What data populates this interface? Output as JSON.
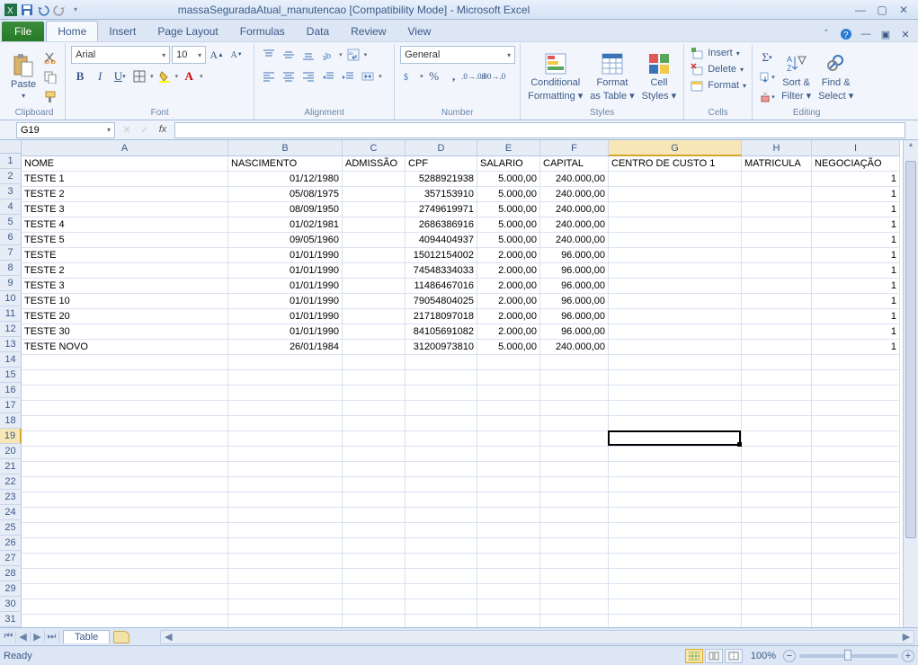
{
  "title": "massaSeguradaAtual_manutencao  [Compatibility Mode] - Microsoft Excel",
  "tabs": {
    "file": "File",
    "home": "Home",
    "insert": "Insert",
    "pagelayout": "Page Layout",
    "formulas": "Formulas",
    "data": "Data",
    "review": "Review",
    "view": "View"
  },
  "ribbon": {
    "clipboard": {
      "paste": "Paste",
      "label": "Clipboard"
    },
    "font": {
      "name": "Arial",
      "size": "10",
      "label": "Font"
    },
    "alignment": {
      "label": "Alignment"
    },
    "number": {
      "format": "General",
      "label": "Number"
    },
    "styles": {
      "cond": "Conditional",
      "cond2": "Formatting",
      "table": "Format",
      "table2": "as Table",
      "cell": "Cell",
      "cell2": "Styles",
      "label": "Styles"
    },
    "cells": {
      "insert": "Insert",
      "delete": "Delete",
      "format": "Format",
      "label": "Cells"
    },
    "editing": {
      "sort": "Sort &",
      "sort2": "Filter",
      "find": "Find &",
      "find2": "Select",
      "label": "Editing"
    }
  },
  "nameBox": "G19",
  "columns": [
    "A",
    "B",
    "C",
    "D",
    "E",
    "F",
    "G",
    "H",
    "I"
  ],
  "rowCount": 31,
  "activeRow": 19,
  "activeCol": "G",
  "headersRow": [
    "NOME",
    "NASCIMENTO",
    "ADMISSÃO",
    "CPF",
    "SALARIO",
    "CAPITAL",
    "CENTRO DE CUSTO 1",
    "MATRICULA",
    "NEGOCIAÇÃO"
  ],
  "rows": [
    {
      "A": "TESTE 1",
      "B": "01/12/1980",
      "C": "",
      "D": "5288921938",
      "E": "5.000,00",
      "F": "240.000,00",
      "G": "",
      "H": "",
      "I": "1"
    },
    {
      "A": "TESTE 2",
      "B": "05/08/1975",
      "C": "",
      "D": "357153910",
      "E": "5.000,00",
      "F": "240.000,00",
      "G": "",
      "H": "",
      "I": "1"
    },
    {
      "A": "TESTE 3",
      "B": "08/09/1950",
      "C": "",
      "D": "2749619971",
      "E": "5.000,00",
      "F": "240.000,00",
      "G": "",
      "H": "",
      "I": "1"
    },
    {
      "A": "TESTE 4",
      "B": "01/02/1981",
      "C": "",
      "D": "2686386916",
      "E": "5.000,00",
      "F": "240.000,00",
      "G": "",
      "H": "",
      "I": "1"
    },
    {
      "A": "TESTE 5",
      "B": "09/05/1960",
      "C": "",
      "D": "4094404937",
      "E": "5.000,00",
      "F": "240.000,00",
      "G": "",
      "H": "",
      "I": "1"
    },
    {
      "A": "TESTE",
      "B": "01/01/1990",
      "C": "",
      "D": "15012154002",
      "E": "2.000,00",
      "F": "96.000,00",
      "G": "",
      "H": "",
      "I": "1"
    },
    {
      "A": "TESTE 2",
      "B": "01/01/1990",
      "C": "",
      "D": "74548334033",
      "E": "2.000,00",
      "F": "96.000,00",
      "G": "",
      "H": "",
      "I": "1"
    },
    {
      "A": "TESTE 3",
      "B": "01/01/1990",
      "C": "",
      "D": "11486467016",
      "E": "2.000,00",
      "F": "96.000,00",
      "G": "",
      "H": "",
      "I": "1"
    },
    {
      "A": "TESTE 10",
      "B": "01/01/1990",
      "C": "",
      "D": "79054804025",
      "E": "2.000,00",
      "F": "96.000,00",
      "G": "",
      "H": "",
      "I": "1"
    },
    {
      "A": "TESTE 20",
      "B": "01/01/1990",
      "C": "",
      "D": "21718097018",
      "E": "2.000,00",
      "F": "96.000,00",
      "G": "",
      "H": "",
      "I": "1"
    },
    {
      "A": "TESTE 30",
      "B": "01/01/1990",
      "C": "",
      "D": "84105691082",
      "E": "2.000,00",
      "F": "96.000,00",
      "G": "",
      "H": "",
      "I": "1"
    },
    {
      "A": "TESTE NOVO",
      "B": "26/01/1984",
      "C": "",
      "D": "31200973810",
      "E": "5.000,00",
      "F": "240.000,00",
      "G": "",
      "H": "",
      "I": "1"
    }
  ],
  "sheetTab": "Table",
  "status": {
    "ready": "Ready",
    "zoom": "100%"
  }
}
